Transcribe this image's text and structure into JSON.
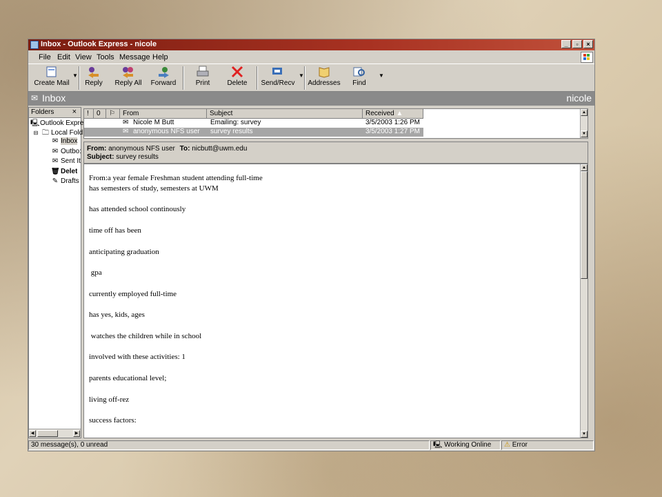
{
  "window": {
    "title": "Inbox - Outlook Express - nicole"
  },
  "menu": [
    "File",
    "Edit",
    "View",
    "Tools",
    "Message",
    "Help"
  ],
  "toolbar": [
    {
      "label": "Create Mail",
      "icon": "create-mail-icon"
    },
    {
      "label": "Reply",
      "icon": "reply-icon"
    },
    {
      "label": "Reply All",
      "icon": "reply-all-icon"
    },
    {
      "label": "Forward",
      "icon": "forward-icon"
    },
    {
      "label": "Print",
      "icon": "print-icon"
    },
    {
      "label": "Delete",
      "icon": "delete-icon"
    },
    {
      "label": "Send/Recv",
      "icon": "send-recv-icon"
    },
    {
      "label": "Addresses",
      "icon": "addresses-icon"
    },
    {
      "label": "Find",
      "icon": "find-icon"
    }
  ],
  "inbox_bar": {
    "title": "Inbox",
    "user": "nicole"
  },
  "folders": {
    "header": "Folders",
    "close": "×",
    "items": [
      {
        "label": "Outlook Expre:",
        "icon": "outlook-express-icon"
      },
      {
        "label": "Local Fold",
        "icon": "local-folders-icon"
      },
      {
        "label": "Inbox",
        "icon": "inbox-icon"
      },
      {
        "label": "Outbo:",
        "icon": "outbox-icon"
      },
      {
        "label": "Sent It",
        "icon": "sent-items-icon"
      },
      {
        "label": "Delet",
        "icon": "deleted-items-icon"
      },
      {
        "label": "Drafts",
        "icon": "drafts-icon"
      }
    ]
  },
  "list": {
    "columns": {
      "priority": "!",
      "attach": "0",
      "flag": "⚐",
      "from": "From",
      "subject": "Subject",
      "received": "Received"
    },
    "rows": [
      {
        "from": "Nicole M Butt",
        "subject": "Emailing: survey",
        "received": "3/5/2003 1:26 PM"
      },
      {
        "from": "anonymous NFS user",
        "subject": "survey results",
        "received": "3/5/2003 1:27 PM"
      }
    ]
  },
  "preview": {
    "from_label": "From:",
    "from": "anonymous NFS user",
    "to_label": "To:",
    "to": "nicbutt@uwm.edu",
    "subject_label": "Subject:",
    "subject": "survey results",
    "body": [
      "From:a  year female Freshman  student  attending full-time",
      "has  semesters of study,  semesters at UWM",
      "has attended school continously",
      "time off has been",
      "anticipating graduation",
      " gpa",
      "currently employed full-time",
      "has yes,  kids, ages",
      " watches the children while in school",
      "involved with these activities: 1",
      "parents educational level;",
      "living off-rez",
      "success factors:"
    ]
  },
  "status": {
    "messages": "30 message(s), 0 unread",
    "online": "Working Online",
    "error": "Error"
  }
}
